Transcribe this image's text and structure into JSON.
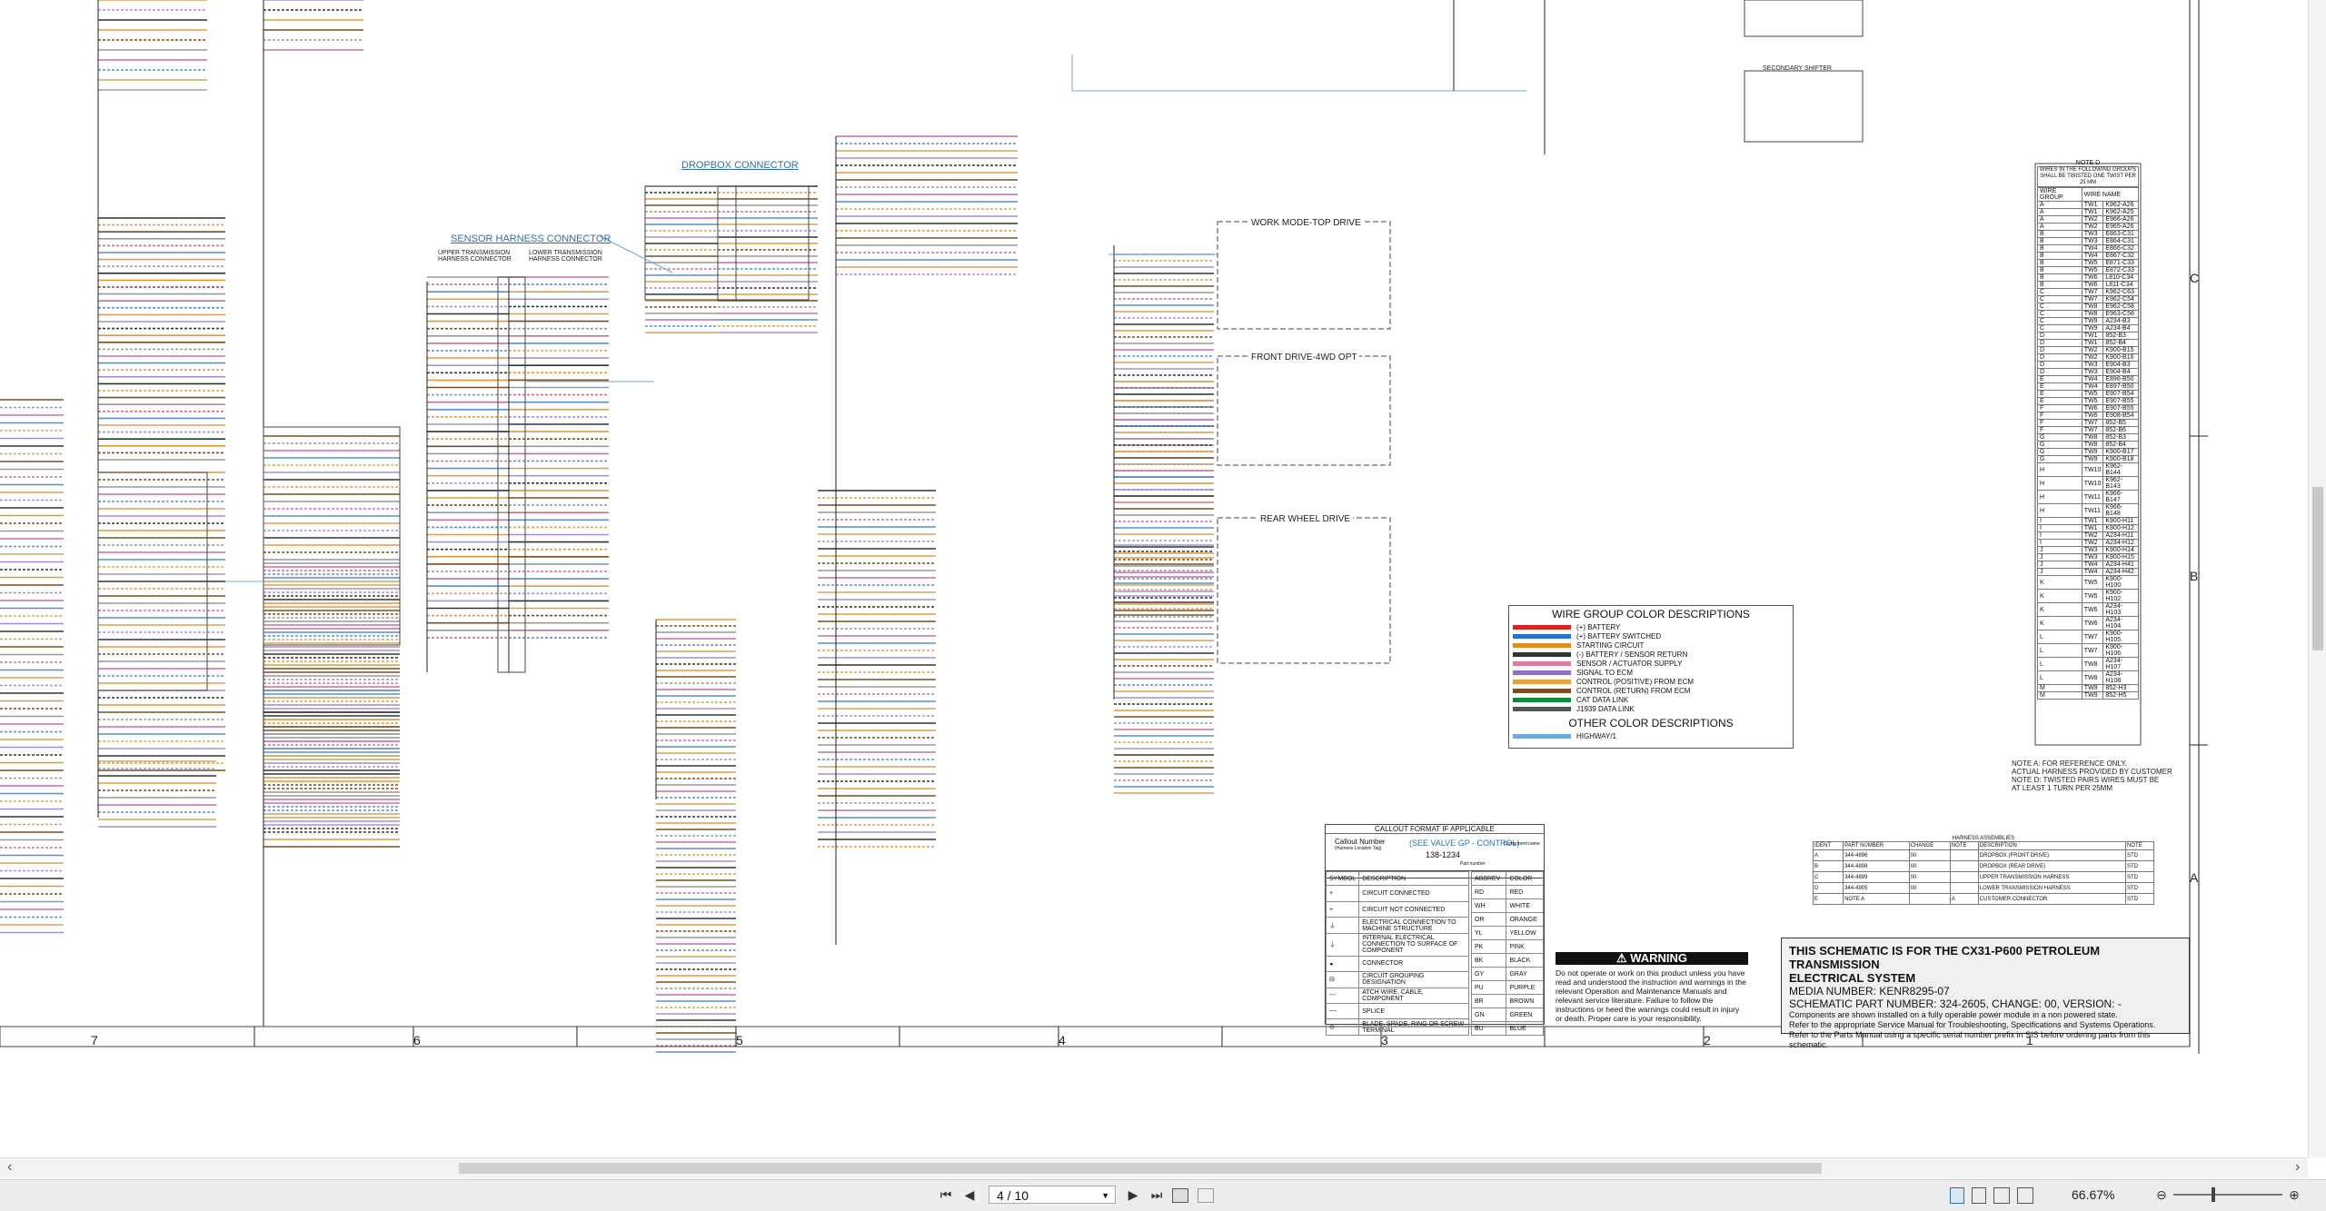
{
  "sheet": {
    "connector_titles": {
      "dropbox": "DROPBOX CONNECTOR",
      "sensor_harness": "SENSOR HARNESS CONNECTOR",
      "upper_trans": "UPPER TRANSMISSION HARNESS CONNECTOR",
      "lower_trans": "LOWER TRANSMISSION HARNESS CONNECTOR"
    },
    "groups": {
      "work_mode": "WORK MODE-TOP DRIVE",
      "front_drive": "FRONT DRIVE-4WD OPT",
      "rear_wheel": "REAR WHEEL DRIVE",
      "secondary_shifter": "SECONDARY SHIFTER"
    },
    "note_d": {
      "title": "NOTE D",
      "header": "WIRES IN THE FOLLOWING GROUPS SHALL BE TWISTED ONE TWIST PER 25 MM",
      "col1": "WIRE GROUP",
      "col2": "WIRE NAME",
      "rows": [
        [
          "A",
          "TW1",
          "K962-A26"
        ],
        [
          "A",
          "TW1",
          "K962-A25"
        ],
        [
          "A",
          "TW2",
          "E966-A26"
        ],
        [
          "A",
          "TW2",
          "E965-A26"
        ],
        [
          "B",
          "TW3",
          "E863-C31"
        ],
        [
          "B",
          "TW3",
          "E864-C31"
        ],
        [
          "B",
          "TW4",
          "E866-C32"
        ],
        [
          "B",
          "TW4",
          "E867-C32"
        ],
        [
          "B",
          "TW5",
          "E871-C33"
        ],
        [
          "B",
          "TW5",
          "E872-C33"
        ],
        [
          "B",
          "TW6",
          "L810-C34"
        ],
        [
          "B",
          "TW6",
          "L811-C34"
        ],
        [
          "C",
          "TW7",
          "K962-C63"
        ],
        [
          "C",
          "TW7",
          "K962-C54"
        ],
        [
          "C",
          "TW8",
          "E962-C58"
        ],
        [
          "C",
          "TW8",
          "E963-C58"
        ],
        [
          "C",
          "TW9",
          "A234-B3"
        ],
        [
          "C",
          "TW9",
          "A234-B4"
        ],
        [
          "D",
          "TW1",
          "852-B3"
        ],
        [
          "D",
          "TW1",
          "852-B4"
        ],
        [
          "D",
          "TW2",
          "K900-B15"
        ],
        [
          "D",
          "TW2",
          "K900-B16"
        ],
        [
          "D",
          "TW3",
          "E904-B3"
        ],
        [
          "D",
          "TW3",
          "E904-B4"
        ],
        [
          "E",
          "TW4",
          "E896-B50"
        ],
        [
          "E",
          "TW4",
          "E897-B50"
        ],
        [
          "E",
          "TW5",
          "E907-B54"
        ],
        [
          "E",
          "TW5",
          "E907-B55"
        ],
        [
          "F",
          "TW6",
          "E907-B55"
        ],
        [
          "F",
          "TW6",
          "E908-B54"
        ],
        [
          "F",
          "TW7",
          "852-B5"
        ],
        [
          "F",
          "TW7",
          "852-B6"
        ],
        [
          "G",
          "TW8",
          "852-B3"
        ],
        [
          "G",
          "TW8",
          "852-B4"
        ],
        [
          "G",
          "TW9",
          "K900-B17"
        ],
        [
          "G",
          "TW9",
          "K900-B18"
        ],
        [
          "H",
          "TW10",
          "K962-B144"
        ],
        [
          "H",
          "TW10",
          "K962-B143"
        ],
        [
          "H",
          "TW11",
          "K966-B147"
        ],
        [
          "H",
          "TW11",
          "K966-B148"
        ],
        [
          "I",
          "TW1",
          "K900-H11"
        ],
        [
          "I",
          "TW1",
          "K900-H12"
        ],
        [
          "I",
          "TW2",
          "A234-H11"
        ],
        [
          "I",
          "TW2",
          "A234-H12"
        ],
        [
          "J",
          "TW3",
          "K900-H14"
        ],
        [
          "J",
          "TW3",
          "K900-H15"
        ],
        [
          "J",
          "TW4",
          "A234-H41"
        ],
        [
          "J",
          "TW4",
          "A234-H42"
        ],
        [
          "K",
          "TW5",
          "K900-H100"
        ],
        [
          "K",
          "TW5",
          "K900-H102"
        ],
        [
          "K",
          "TW6",
          "A234-H103"
        ],
        [
          "K",
          "TW6",
          "A234-H104"
        ],
        [
          "L",
          "TW7",
          "K900-H105"
        ],
        [
          "L",
          "TW7",
          "K900-H106"
        ],
        [
          "L",
          "TW8",
          "A234-H107"
        ],
        [
          "L",
          "TW8",
          "A234-H108"
        ],
        [
          "M",
          "TW9",
          "852-H3"
        ],
        [
          "M",
          "TW9",
          "852-H5"
        ]
      ]
    },
    "note_a": [
      "NOTE A: FOR REFERENCE ONLY.",
      "ACTUAL HARNESS PROVIDED BY CUSTOMER",
      "NOTE D: TWISTED PAIRS WIRES MUST BE",
      "AT LEAST 1 TURN PER 25MM"
    ],
    "harness_assemblies": {
      "title": "HARNESS ASSEMBLIES",
      "cols": [
        "IDENT",
        "PART NUMBER",
        "CHANGE",
        "NOTE",
        "DESCRIPTION",
        "NOTE"
      ],
      "rows": [
        [
          "A",
          "344-4896",
          "00",
          "",
          "DROPBOX (FRONT DRIVE)",
          "STD"
        ],
        [
          "B",
          "344-4898",
          "00",
          "",
          "DROPBOX (REAR DRIVE)",
          "STD"
        ],
        [
          "C",
          "344-4899",
          "00",
          "",
          "UPPER TRANSMISSION HARNESS",
          "STD"
        ],
        [
          "D",
          "344-4905",
          "00",
          "",
          "LOWER TRANSMISSION HARNESS",
          "STD"
        ],
        [
          "E",
          "NOTE A",
          "",
          "A",
          "CUSTOMER CONNECTOR",
          "STD"
        ]
      ]
    },
    "wire_group": {
      "title": "WIRE GROUP COLOR DESCRIPTIONS",
      "rows": [
        {
          "label": "(+) BATTERY",
          "color": "#d22"
        },
        {
          "label": "(+) BATTERY SWITCHED",
          "color": "#2a6fd6"
        },
        {
          "label": "STARTING CIRCUIT",
          "color": "#e58a1f"
        },
        {
          "label": "(-) BATTERY / SENSOR RETURN",
          "color": "#333333"
        },
        {
          "label": "SENSOR / ACTUATOR SUPPLY",
          "color": "#e07a9a"
        },
        {
          "label": "SIGNAL TO ECM",
          "color": "#8a6fc8"
        },
        {
          "label": "CONTROL (POSITIVE) FROM ECM",
          "color": "#e7a23a"
        },
        {
          "label": "CONTROL (RETURN) FROM ECM",
          "color": "#7b4e24"
        },
        {
          "label": "CAT DATA LINK",
          "color": "#0b8a3a"
        },
        {
          "label": "J1939 DATA LINK",
          "color": "#555555"
        }
      ],
      "other_title": "OTHER COLOR DESCRIPTIONS",
      "other_rows": [
        {
          "label": "HIGHWAY/1",
          "color": "#6fa8dc"
        }
      ]
    },
    "callout": {
      "title": "CALLOUT FORMAT IF APPLICABLE",
      "callout_number": "Callout Number",
      "callout_sub": "(Harness Location Tag)",
      "component": "Component Location Code",
      "example": "(SEE VALVE GP - CONTROL)",
      "part": "138-1234",
      "part_label": "Part number",
      "comp_name": "Component name"
    },
    "symbol_table": {
      "headers": [
        "SYMBOL",
        "DESCRIPTION"
      ],
      "rows": [
        [
          "+",
          "CIRCUIT CONNECTED"
        ],
        [
          "+",
          "CIRCUIT NOT CONNECTED"
        ],
        [
          "⏚",
          "ELECTRICAL CONNECTION TO MACHINE STRUCTURE"
        ],
        [
          "⏚",
          "INTERNAL ELECTRICAL CONNECTION TO SURFACE OF COMPONENT"
        ],
        [
          "◂",
          "CONNECTOR"
        ],
        [
          "⊟",
          "CIRCUIT GROUPING DESIGNATION"
        ],
        [
          "---",
          "ATCH WIRE, CABLE, COMPONENT"
        ],
        [
          "~~",
          "SPLICE"
        ],
        [
          "⊙",
          "BLADE, SPADE, RING OR SCREW TERMINAL"
        ]
      ]
    },
    "abbr_table": {
      "headers": [
        "ABBREV",
        "COLOR"
      ],
      "rows": [
        [
          "RD",
          "RED"
        ],
        [
          "WH",
          "WHITE"
        ],
        [
          "OR",
          "ORANGE"
        ],
        [
          "YL",
          "YELLOW"
        ],
        [
          "PK",
          "PINK"
        ],
        [
          "BK",
          "BLACK"
        ],
        [
          "GY",
          "GRAY"
        ],
        [
          "PU",
          "PURPLE"
        ],
        [
          "BR",
          "BROWN"
        ],
        [
          "GN",
          "GREEN"
        ],
        [
          "BU",
          "BLUE"
        ]
      ]
    },
    "warning": {
      "head": "⚠ WARNING",
      "body": "Do not operate or work on this product unless you have read and understood the instruction and warnings in the relevant Operation and Maintenance Manuals and relevant service literature. Failure to follow the instructions or heed the warnings could result in injury or death. Proper care is your responsibility."
    },
    "title_block": {
      "line1": "THIS SCHEMATIC IS FOR THE CX31-P600 PETROLEUM TRANSMISSION",
      "line2": "ELECTRICAL SYSTEM",
      "media": "MEDIA NUMBER: KENR8295-07",
      "part": "SCHEMATIC PART NUMBER: 324-2605, CHANGE: 00, VERSION: -",
      "note1": "Components are shown installed on a fully operable power module in a non powered state.",
      "note2": "Refer to the appropriate Service Manual for Troubleshooting, Specifications and Systems Operations.",
      "note3": "Refer to the Parts Manual using a specific serial number prefix in SIS before ordering parts from this schematic."
    },
    "zones_bottom": [
      "7",
      "6",
      "5",
      "4",
      "3",
      "2",
      "1"
    ],
    "zones_right": [
      "C",
      "B",
      "A"
    ]
  },
  "toolbar": {
    "page_value": "4 / 10",
    "zoom": "66.67%",
    "first_page": "⏮",
    "prev_page": "◀",
    "next_page": "▶",
    "last_page": "⏭",
    "zoom_out": "⊖",
    "zoom_in": "⊕",
    "scroll_left": "‹",
    "scroll_right": "›"
  }
}
